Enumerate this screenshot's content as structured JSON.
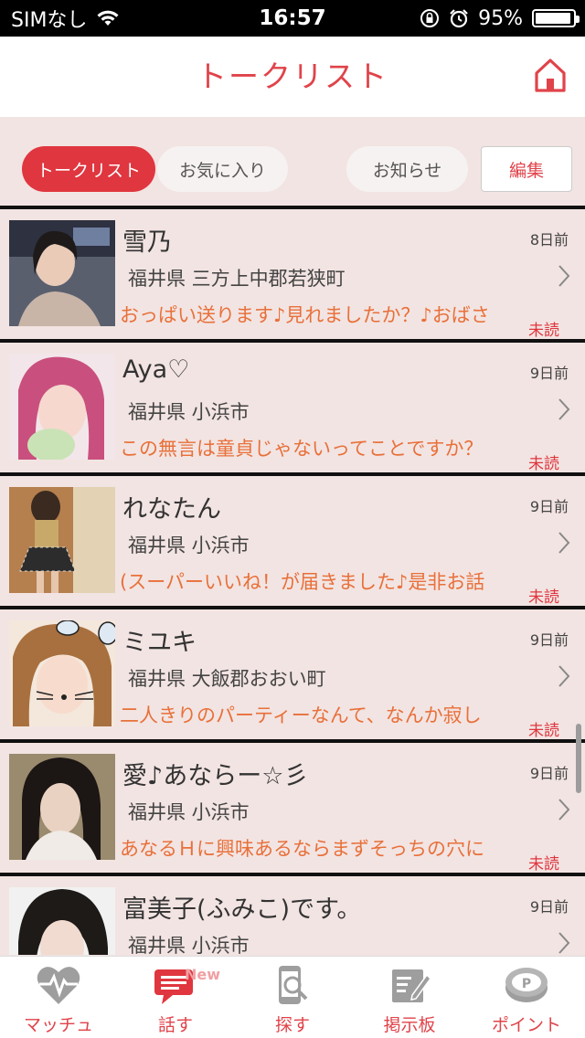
{
  "status_bar": {
    "carrier": "SIMなし",
    "time": "16:57",
    "battery": "95%",
    "battery_level": 0.95
  },
  "header": {
    "title": "トークリスト",
    "home_icon": "home-icon"
  },
  "tabs": {
    "talk_list": "トークリスト",
    "favorites": "お気に入り",
    "notices": "お知らせ",
    "edit": "編集"
  },
  "list_items": [
    {
      "name": "雪乃",
      "time": "8日前",
      "location": "福井県 三方上中郡若狭町",
      "message": "おっぱい送ります♪見れましたか？♪おばさ",
      "unread": "未読"
    },
    {
      "name": "Aya♡",
      "time": "9日前",
      "location": "福井県 小浜市",
      "message": "この無言は童貞じゃないってことですか？",
      "unread": "未読"
    },
    {
      "name": "れなたん",
      "time": "9日前",
      "location": "福井県 小浜市",
      "message": "(スーパーいいね！が届きました♪是非お話",
      "unread": "未読"
    },
    {
      "name": "ミユキ",
      "time": "9日前",
      "location": "福井県 大飯郡おおい町",
      "message": "二人きりのパーティーなんて、なんか寂し",
      "unread": "未読"
    },
    {
      "name": "愛♪あならー☆彡",
      "time": "9日前",
      "location": "福井県 小浜市",
      "message": "あなるＨに興味あるならまずそっちの穴に",
      "unread": "未読"
    },
    {
      "name": "富美子(ふみこ)です。",
      "time": "9日前",
      "location": "福井県 小浜市",
      "message": "",
      "unread": ""
    }
  ],
  "bottom_nav": {
    "match": "マッチュ",
    "talk": "話す",
    "talk_badge": "New",
    "search": "探す",
    "board": "掲示板",
    "points": "ポイント"
  },
  "colors": {
    "accent": "#e0434a",
    "message": "#e8703a",
    "background": "#f2e4e2"
  }
}
